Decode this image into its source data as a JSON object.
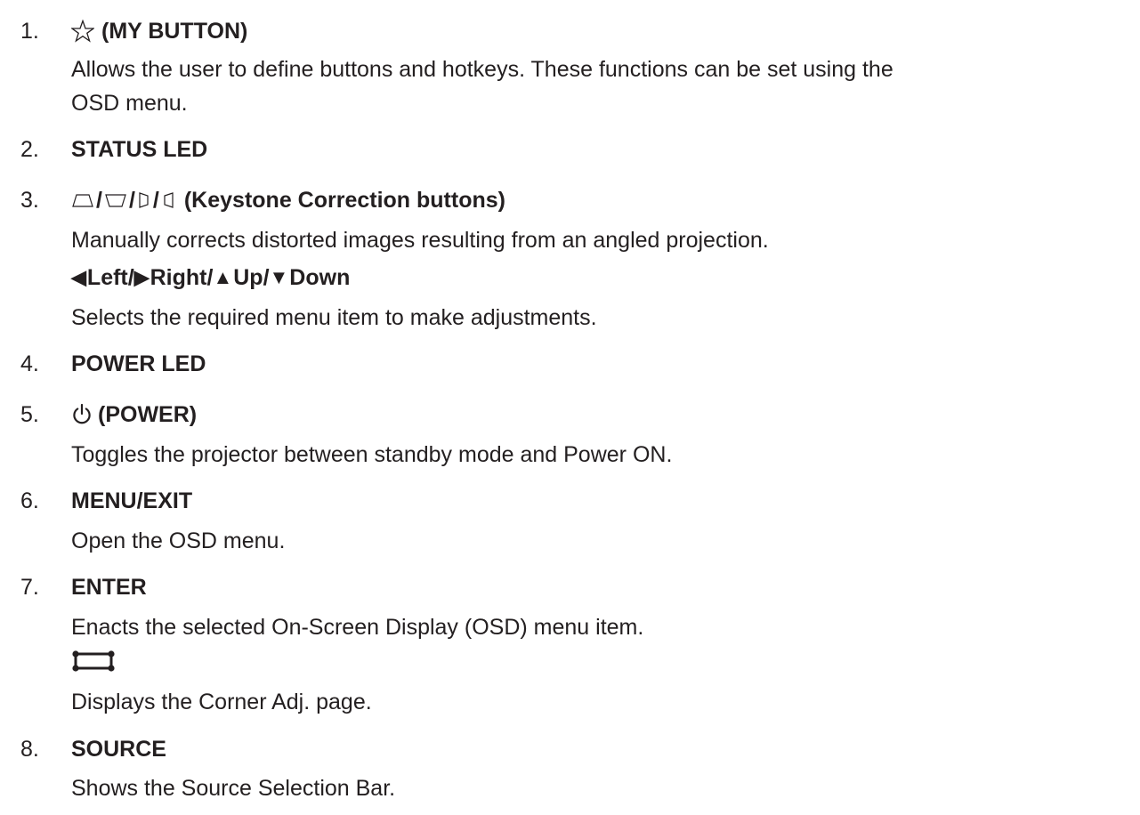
{
  "items": [
    {
      "number": "1.",
      "heading": "(MY BUTTON)",
      "icon": "star-outline-icon",
      "description": [
        "Allows the user to define buttons and hotkeys. These functions can be set using the",
        "OSD menu."
      ]
    },
    {
      "number": "2.",
      "heading": "STATUS LED"
    },
    {
      "number": "3.",
      "heading": "(Keystone Correction buttons)",
      "icons": [
        "keystone-top-icon",
        "keystone-bottom-icon",
        "keystone-right-icon",
        "keystone-left-icon"
      ],
      "separator": "/",
      "description": [
        "Manually corrects distorted images resulting from an angled projection."
      ],
      "sub": {
        "arrows": [
          "◀",
          "▶",
          "▲",
          "▼"
        ],
        "labels": [
          "Left",
          "Right",
          "Up",
          "Down"
        ],
        "description": "Selects the required menu item to make adjustments."
      }
    },
    {
      "number": "4.",
      "heading": "POWER LED"
    },
    {
      "number": "5.",
      "heading": "(POWER)",
      "icon": "power-icon",
      "description": [
        "Toggles the projector between standby mode and Power ON."
      ]
    },
    {
      "number": "6.",
      "heading": "MENU/EXIT",
      "description": [
        "Open the OSD menu."
      ]
    },
    {
      "number": "7.",
      "heading": "ENTER",
      "description": [
        "Enacts the selected On-Screen Display (OSD) menu item."
      ],
      "sub": {
        "icon": "corner-adjust-icon",
        "description": "Displays the Corner Adj. page."
      }
    },
    {
      "number": "8.",
      "heading": "SOURCE",
      "description": [
        "Shows the Source Selection Bar."
      ]
    }
  ]
}
